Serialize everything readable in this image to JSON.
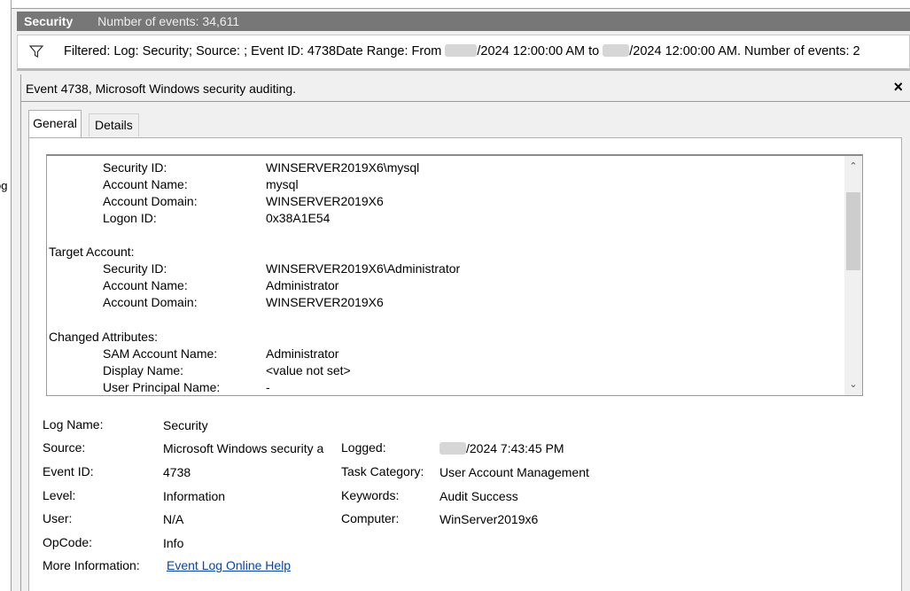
{
  "left_strip": {
    "clipped_text": "og"
  },
  "titlebar": {
    "log_name": "Security",
    "event_count": "Number of events: 34,611"
  },
  "filter": {
    "part1": "Filtered: Log: Security; Source: ; Event ID: 4738Date Range: From ",
    "part2": "/2024 12:00:00 AM to ",
    "part3": "/2024 12:00:00 AM. Number of events: 2",
    "icon": "filter-funnel-icon"
  },
  "detail": {
    "title": "Event 4738, Microsoft Windows security auditing.",
    "close_label": "×"
  },
  "tabs": {
    "general": "General",
    "details": "Details"
  },
  "event_text": {
    "subject": {
      "security_id_label": "Security ID:",
      "security_id": "WINSERVER2019X6\\mysql",
      "account_name_label": "Account Name:",
      "account_name": "mysql",
      "account_domain_label": "Account Domain:",
      "account_domain": "WINSERVER2019X6",
      "logon_id_label": "Logon ID:",
      "logon_id": "0x38A1E54"
    },
    "target": {
      "heading": "Target Account:",
      "security_id_label": "Security ID:",
      "security_id": "WINSERVER2019X6\\Administrator",
      "account_name_label": "Account Name:",
      "account_name": "Administrator",
      "account_domain_label": "Account Domain:",
      "account_domain": "WINSERVER2019X6"
    },
    "changed": {
      "heading": "Changed Attributes:",
      "sam_label": "SAM Account Name:",
      "sam": "Administrator",
      "display_label": "Display Name:",
      "display": "<value not set>",
      "upn_label": "User Principal Name:",
      "upn": "-"
    }
  },
  "properties": {
    "log_name_label": "Log Name:",
    "log_name": "Security",
    "source_label": "Source:",
    "source": "Microsoft Windows security a",
    "logged_label": "Logged:",
    "logged": "/2024 7:43:45 PM",
    "event_id_label": "Event ID:",
    "event_id": "4738",
    "task_category_label": "Task Category:",
    "task_category": "User Account Management",
    "level_label": "Level:",
    "level": "Information",
    "keywords_label": "Keywords:",
    "keywords": "Audit Success",
    "user_label": "User:",
    "user": "N/A",
    "computer_label": "Computer:",
    "computer": "WinServer2019x6",
    "opcode_label": "OpCode:",
    "opcode": "Info",
    "more_info_label": "More Information:",
    "more_info_link": "Event Log Online Help"
  },
  "colors": {
    "titlebar_bg": "#777777",
    "link": "#0645ad"
  }
}
